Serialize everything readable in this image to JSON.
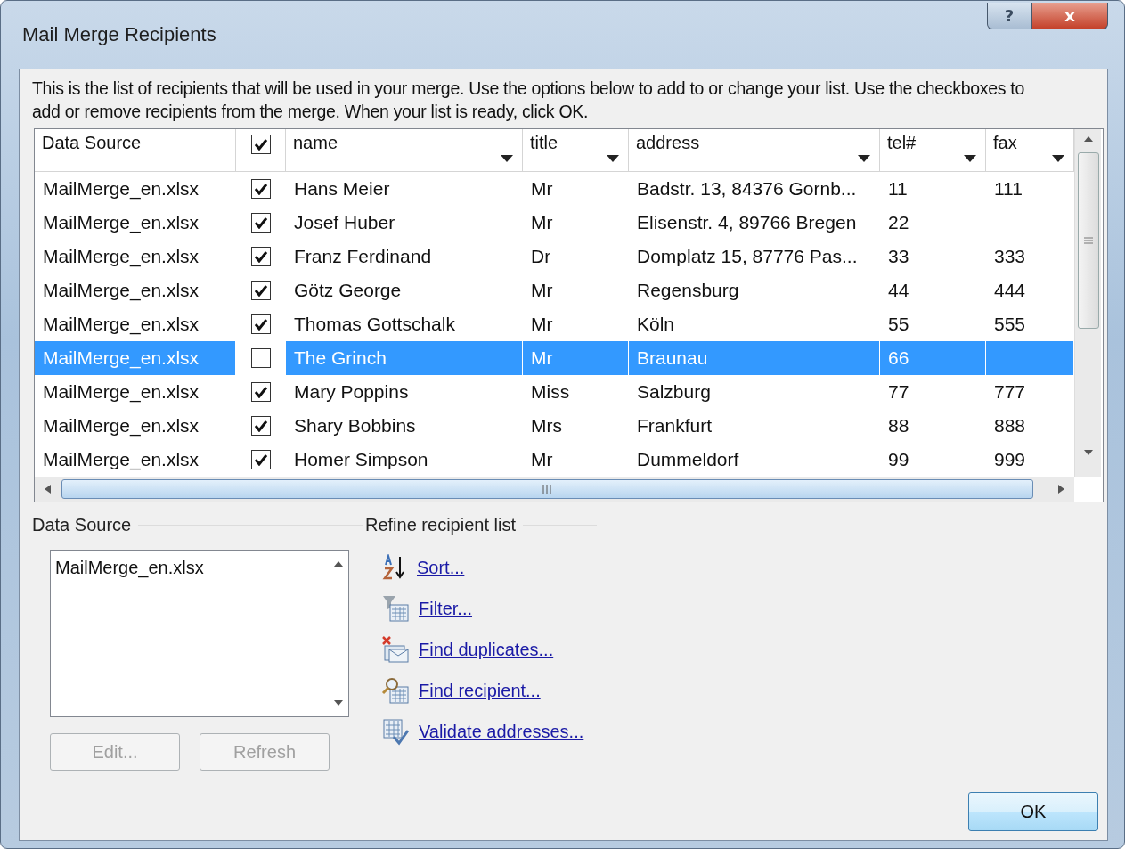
{
  "window": {
    "title": "Mail Merge Recipients",
    "help": "?",
    "close": "x"
  },
  "intro": "This is the list of recipients that will be used in your merge.  Use the options below to add to or change your list.  Use the checkboxes to add or remove recipients from the merge.  When your list is ready, click OK.",
  "table": {
    "source_header": "Data Source",
    "header_checked": true,
    "columns": [
      "name",
      "title",
      "address",
      "tel#",
      "fax"
    ],
    "rows": [
      {
        "source": "MailMerge_en.xlsx",
        "checked": true,
        "selected": false,
        "cells": [
          "Hans Meier",
          "Mr",
          "Badstr. 13, 84376 Gornb...",
          "11",
          "111"
        ]
      },
      {
        "source": "MailMerge_en.xlsx",
        "checked": true,
        "selected": false,
        "cells": [
          "Josef Huber",
          "Mr",
          "Elisenstr. 4, 89766 Bregen",
          "22"
        ]
      },
      {
        "source": "MailMerge_en.xlsx",
        "checked": true,
        "selected": false,
        "cells": [
          "Franz Ferdinand",
          "Dr",
          "Domplatz 15, 87776 Pas...",
          "33",
          "333"
        ]
      },
      {
        "source": "MailMerge_en.xlsx",
        "checked": true,
        "selected": false,
        "cells": [
          "Götz George",
          "Mr",
          "Regensburg",
          "44",
          "444"
        ]
      },
      {
        "source": "MailMerge_en.xlsx",
        "checked": true,
        "selected": false,
        "cells": [
          "Thomas Gottschalk",
          "Mr",
          "Köln",
          "55",
          "555"
        ]
      },
      {
        "source": "MailMerge_en.xlsx",
        "checked": false,
        "selected": true,
        "cells": [
          "The Grinch",
          "Mr",
          "Braunau",
          "66"
        ]
      },
      {
        "source": "MailMerge_en.xlsx",
        "checked": true,
        "selected": false,
        "cells": [
          "Mary Poppins",
          "Miss",
          "Salzburg",
          "77",
          "777"
        ]
      },
      {
        "source": "MailMerge_en.xlsx",
        "checked": true,
        "selected": false,
        "cells": [
          "Shary Bobbins",
          "Mrs",
          "Frankfurt",
          "88",
          "888"
        ]
      },
      {
        "source": "MailMerge_en.xlsx",
        "checked": true,
        "selected": false,
        "cells": [
          "Homer Simpson",
          "Mr",
          "Dummeldorf",
          "99",
          "999"
        ]
      }
    ]
  },
  "data_source": {
    "title": "Data Source",
    "items": [
      "MailMerge_en.xlsx"
    ],
    "buttons": [
      {
        "label": "Edit...",
        "disabled": true
      },
      {
        "label": "Refresh",
        "disabled": true
      }
    ]
  },
  "refine": {
    "title": "Refine recipient list",
    "links": [
      {
        "kind": "sort",
        "label": "Sort..."
      },
      {
        "kind": "filter",
        "label": "Filter..."
      },
      {
        "kind": "duplicates",
        "label": "Find duplicates..."
      },
      {
        "kind": "find",
        "label": "Find recipient..."
      },
      {
        "kind": "validate",
        "label": "Validate addresses..."
      }
    ]
  },
  "ok": "OK"
}
